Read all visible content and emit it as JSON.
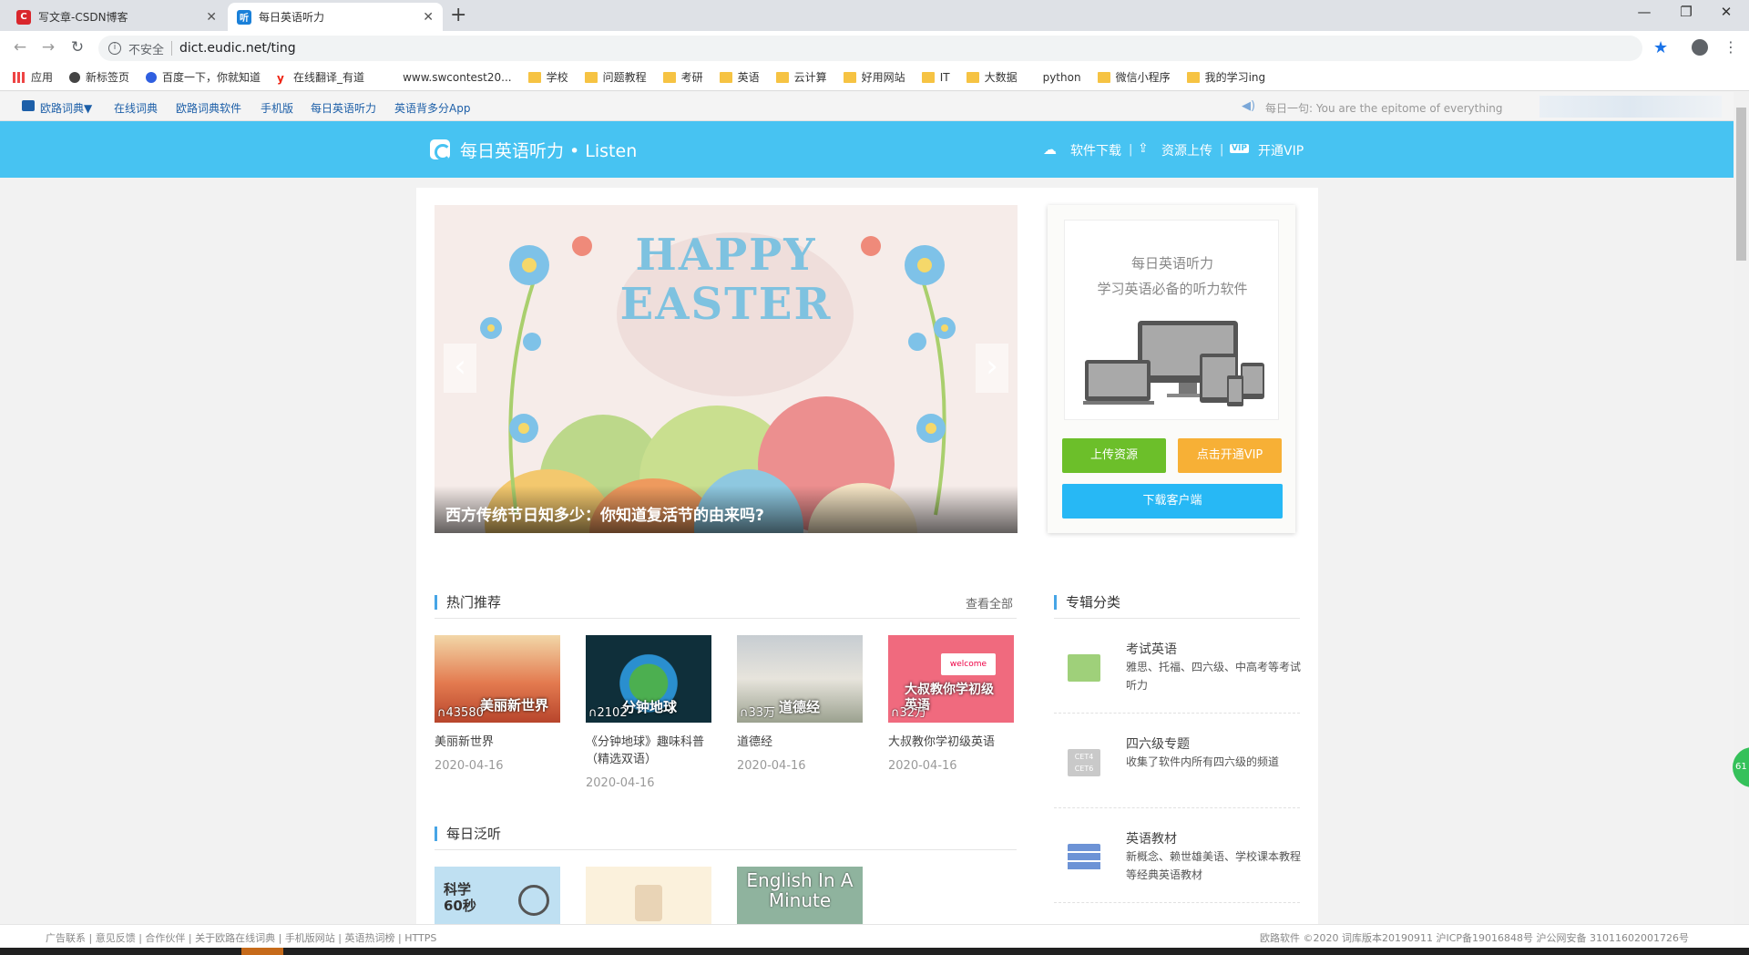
{
  "browser": {
    "tabs": [
      {
        "title": "写文章-CSDN博客",
        "icon_text": "C",
        "color": "#d9262c"
      },
      {
        "title": "每日英语听力",
        "icon_text": "听",
        "color": "#1a80d9"
      }
    ],
    "new_tab_icon": "plus-icon",
    "window_controls": [
      "minimize-icon",
      "restore-icon",
      "close-icon"
    ],
    "security_label": "不安全",
    "url": "dict.eudic.net/ting",
    "bookmarks": [
      {
        "label": "应用",
        "type": "apps"
      },
      {
        "label": "新标签页",
        "type": "globe"
      },
      {
        "label": "百度一下，你就知道",
        "type": "baidu"
      },
      {
        "label": "在线翻译_有道",
        "type": "youdao"
      },
      {
        "label": "www.swcontest20...",
        "type": "blank"
      },
      {
        "label": "学校",
        "type": "folder"
      },
      {
        "label": "问题教程",
        "type": "folder"
      },
      {
        "label": "考研",
        "type": "folder"
      },
      {
        "label": "英语",
        "type": "folder"
      },
      {
        "label": "云计算",
        "type": "folder"
      },
      {
        "label": "好用网站",
        "type": "folder"
      },
      {
        "label": "IT",
        "type": "folder"
      },
      {
        "label": "大数据",
        "type": "folder"
      },
      {
        "label": "python",
        "type": "blank"
      },
      {
        "label": "微信小程序",
        "type": "folder"
      },
      {
        "label": "我的学习ing",
        "type": "folder"
      }
    ]
  },
  "eudic_nav": {
    "links": [
      "欧路词典▼",
      "在线词典",
      "欧路词典软件",
      "手机版",
      "每日英语听力",
      "英语背多分App"
    ],
    "sentence_label": "每日一句:",
    "sentence": "You are the epitome of everything"
  },
  "header": {
    "title": "每日英语听力 • Listen",
    "links": [
      "软件下载",
      "资源上传",
      "开通VIP"
    ]
  },
  "banner": {
    "heading_line1": "HAPPY",
    "heading_line2": "EASTER",
    "caption": "西方传统节日知多少：你知道复活节的由来吗?"
  },
  "side": {
    "title": "每日英语听力",
    "subtitle": "学习英语必备的听力软件",
    "upload_btn": "上传资源",
    "vip_btn": "点击开通VIP",
    "download_btn": "下载客户端",
    "colors": {
      "upload": "#6cbf2a",
      "vip": "#f7b036",
      "download": "#27b8f5"
    }
  },
  "hot": {
    "title": "热门推荐",
    "more": "查看全部",
    "items": [
      {
        "overlay": "美丽新世界",
        "count": "∩43580",
        "name": "美丽新世界",
        "date": "2020-04-16"
      },
      {
        "overlay": "分钟地球",
        "count": "∩2102",
        "name": "《分钟地球》趣味科普（精选双语）",
        "date": "2020-04-16"
      },
      {
        "overlay": "道德经",
        "count": "∩33万",
        "name": "道德经",
        "date": "2020-04-16"
      },
      {
        "overlay": "大叔教你学初级英语",
        "count": "∩32万",
        "name": "大叔教你学初级英语",
        "date": "2020-04-16"
      }
    ]
  },
  "daily": {
    "title": "每日泛听",
    "items": [
      {
        "overlay": "科学60秒"
      },
      {
        "overlay": ""
      },
      {
        "overlay": "English In A Minute"
      }
    ]
  },
  "categories": {
    "title": "专辑分类",
    "items": [
      {
        "name": "考试英语",
        "desc": "雅思、托福、四六级、中高考等考试听力",
        "icon": "exam-icon"
      },
      {
        "name": "四六级专题",
        "desc": "收集了软件内所有四六级的频道",
        "icon": "cet-icon"
      },
      {
        "name": "英语教材",
        "desc": "新概念、赖世雄美语、学校课本教程等经典英语教材",
        "icon": "books-icon"
      }
    ]
  },
  "footer": {
    "links": [
      "广告联系",
      "意见反馈",
      "合作伙伴",
      "关于欧路在线词典",
      "手机版网站",
      "英语热词榜",
      "HTTPS"
    ],
    "copyright": "欧路软件 ©2020 词库版本20190911 沪ICP备19016848号 沪公网安备 31011602001726号"
  },
  "float_badge": "61"
}
